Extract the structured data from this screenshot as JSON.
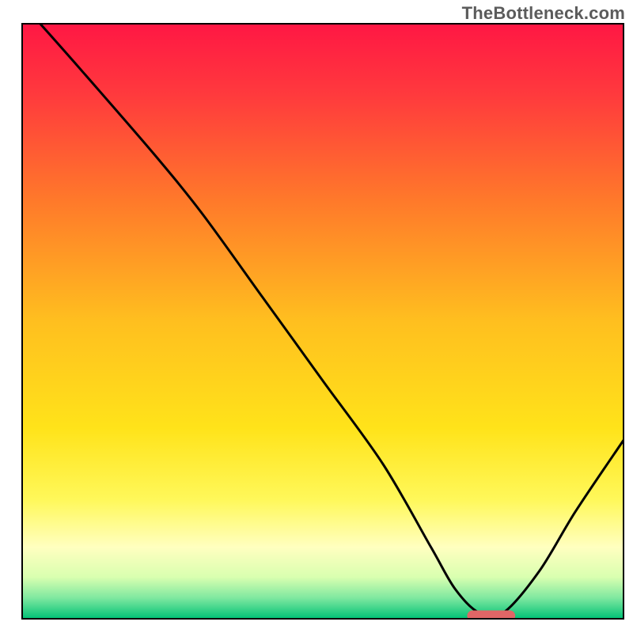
{
  "watermark": "TheBottleneck.com",
  "chart_data": {
    "type": "line",
    "title": "",
    "xlabel": "",
    "ylabel": "",
    "xlim": [
      0,
      100
    ],
    "ylim": [
      0,
      100
    ],
    "background": {
      "type": "vertical-gradient",
      "stops": [
        {
          "offset": 0.0,
          "color": "#ff1744"
        },
        {
          "offset": 0.12,
          "color": "#ff3a3d"
        },
        {
          "offset": 0.3,
          "color": "#ff7a2a"
        },
        {
          "offset": 0.5,
          "color": "#ffbf1f"
        },
        {
          "offset": 0.68,
          "color": "#ffe31a"
        },
        {
          "offset": 0.8,
          "color": "#fff85a"
        },
        {
          "offset": 0.88,
          "color": "#ffffc0"
        },
        {
          "offset": 0.93,
          "color": "#d9ffb0"
        },
        {
          "offset": 0.965,
          "color": "#7fe8a0"
        },
        {
          "offset": 1.0,
          "color": "#00c176"
        }
      ]
    },
    "series": [
      {
        "name": "bottleneck-curve",
        "color": "#000000",
        "x": [
          3,
          10,
          22,
          30,
          40,
          50,
          60,
          68,
          72,
          76,
          80,
          86,
          92,
          100
        ],
        "y": [
          100,
          92,
          78,
          68,
          54,
          40,
          26,
          12,
          5,
          1,
          1,
          8,
          18,
          30
        ]
      }
    ],
    "marker": {
      "name": "optimal-zone",
      "color": "#e06666",
      "x_center": 78,
      "y": 0.5,
      "width": 8,
      "height": 1.8,
      "rx": 1.0
    },
    "axes": {
      "grid": false,
      "ticks": false
    }
  }
}
